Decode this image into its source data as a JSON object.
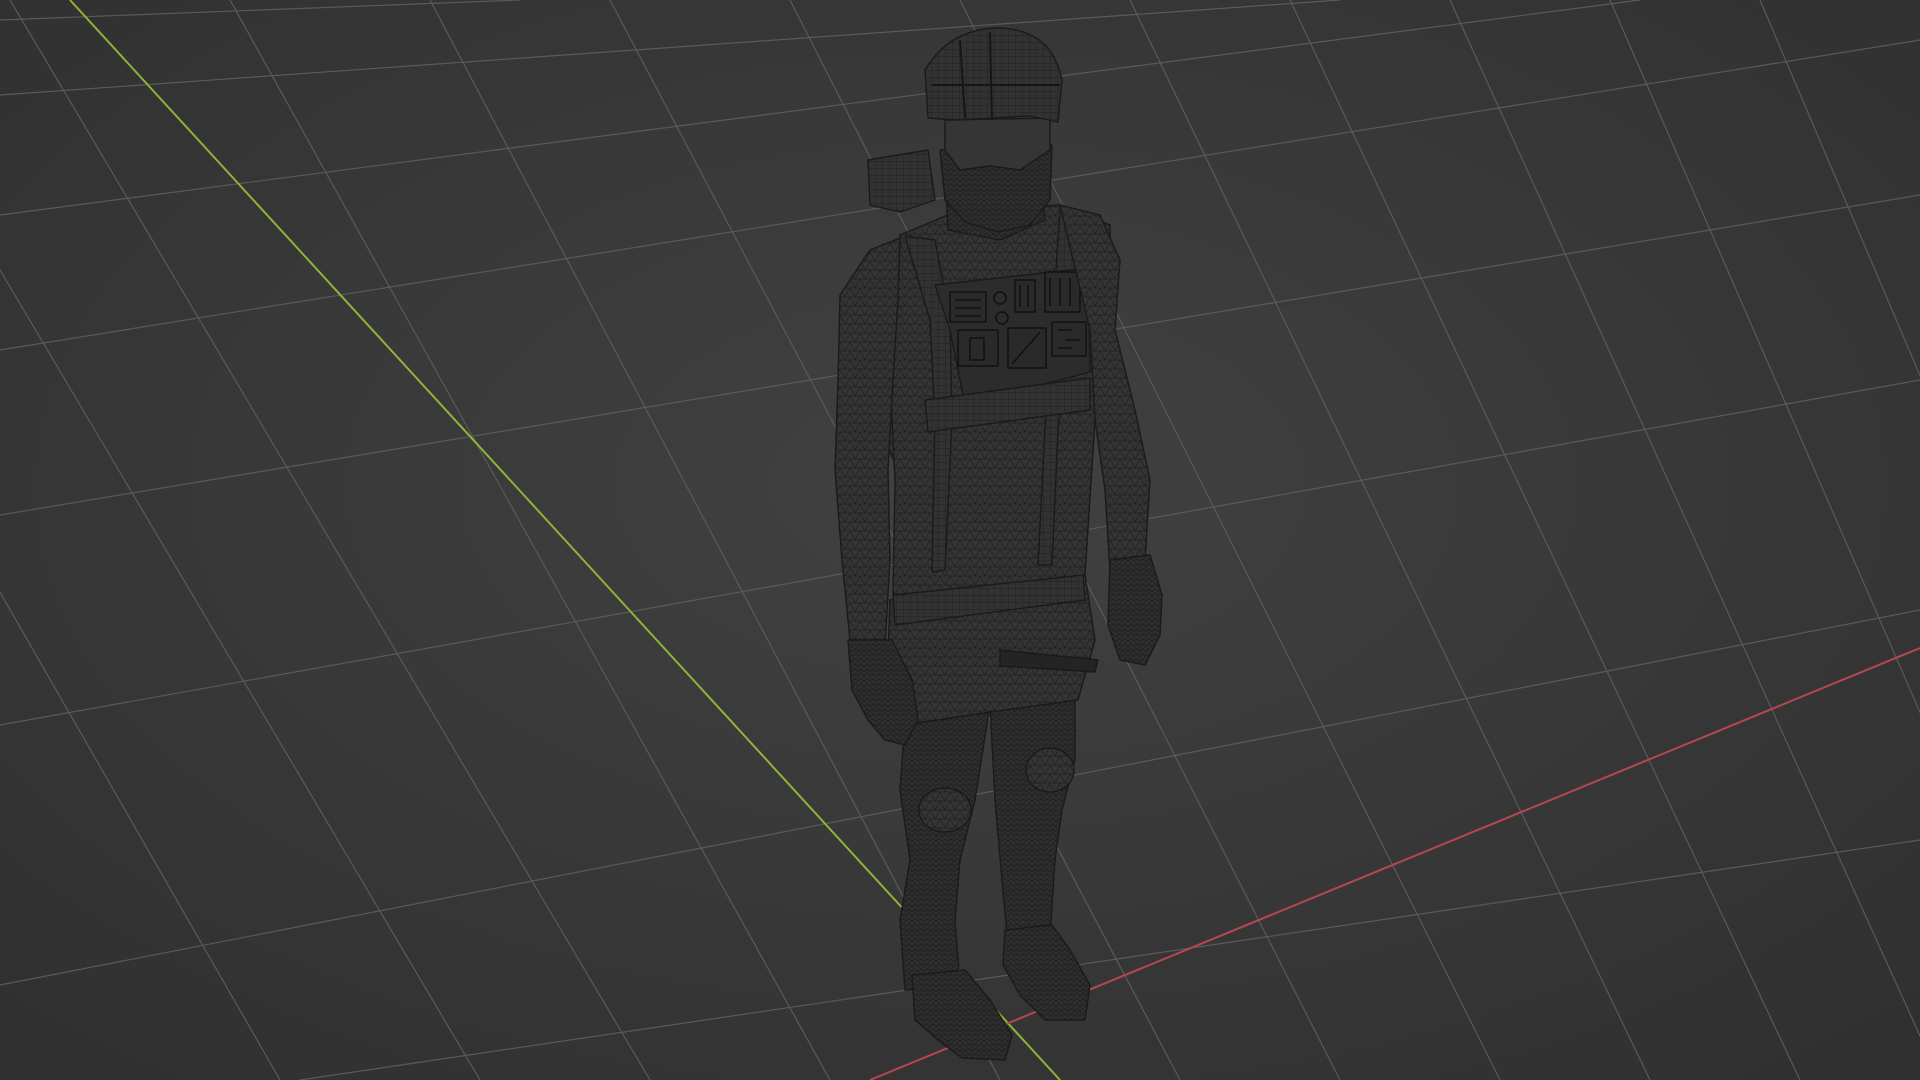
{
  "viewport": {
    "background_color": "#3b3b3b",
    "vignette_color": "#2e2e2e",
    "grid_color": "#5a5a5a",
    "x_axis_color": "#b5474f",
    "y_axis_color": "#8fb33a",
    "wire_color": "#1c1c1c",
    "mesh_fill_color": "#333333",
    "mesh_shade_color": "#2a2a2a",
    "object": "character-wireframe-model"
  }
}
